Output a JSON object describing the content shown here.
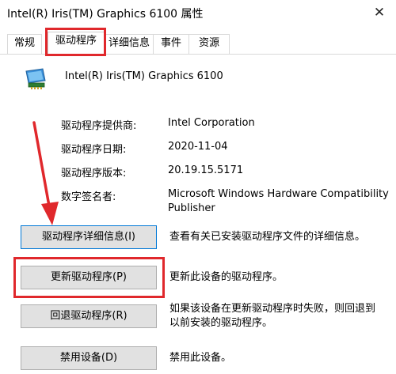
{
  "window": {
    "title": "Intel(R) Iris(TM) Graphics 6100 属性",
    "close_glyph": "✕"
  },
  "tabs": [
    {
      "label": "常规"
    },
    {
      "label": "驱动程序"
    },
    {
      "label": "详细信息"
    },
    {
      "label": "事件"
    },
    {
      "label": "资源"
    }
  ],
  "device": {
    "name": "Intel(R) Iris(TM) Graphics 6100",
    "icon": "display-adapter-icon"
  },
  "properties": [
    {
      "label": "驱动程序提供商:",
      "value": "Intel Corporation"
    },
    {
      "label": "驱动程序日期:",
      "value": "2020-11-04"
    },
    {
      "label": "驱动程序版本:",
      "value": "20.19.15.5171"
    },
    {
      "label": "数字签名者:",
      "value_line1": "Microsoft Windows Hardware Compatibility",
      "value_line2": "Publisher"
    }
  ],
  "actions": [
    {
      "button": "驱动程序详细信息(I)",
      "desc": "查看有关已安装驱动程序文件的详细信息。"
    },
    {
      "button": "更新驱动程序(P)",
      "desc": "更新此设备的驱动程序。"
    },
    {
      "button": "回退驱动程序(R)",
      "desc_line1": "如果该设备在更新驱动程序时失败，则回退到",
      "desc_line2": "以前安装的驱动程序。"
    },
    {
      "button": "禁用设备(D)",
      "desc": "禁用此设备。"
    }
  ],
  "colors": {
    "highlight": "#e0282c",
    "arrow": "#e0282c",
    "focus": "#0078d7"
  }
}
